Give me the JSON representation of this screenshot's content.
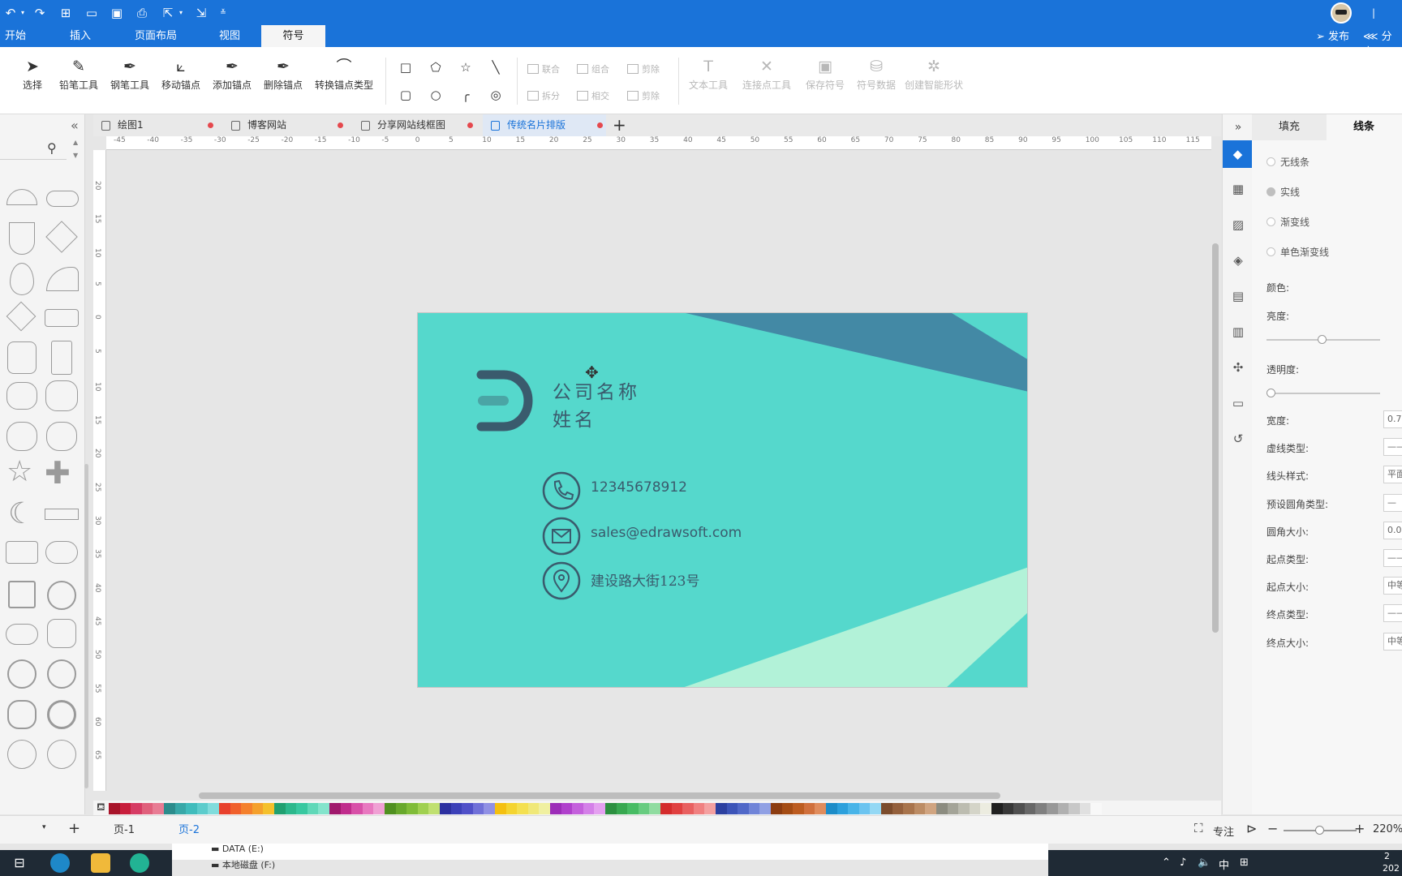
{
  "menu": {
    "items": [
      "开始",
      "插入",
      "页面布局",
      "视图",
      "符号"
    ],
    "active": "符号",
    "publish": "发布",
    "share": "分享"
  },
  "ribbon": {
    "tools": [
      "选择",
      "铅笔工具",
      "钢笔工具",
      "移动锚点",
      "添加锚点",
      "删除锚点",
      "转换锚点类型"
    ],
    "ops": [
      "联合",
      "组合",
      "剪除",
      "拆分",
      "相交",
      "剪除"
    ],
    "tools2": [
      "文本工具",
      "连接点工具",
      "保存符号",
      "符号数据",
      "创建智能形状"
    ]
  },
  "tabs": [
    {
      "label": "绘图1",
      "active": false
    },
    {
      "label": "博客网站",
      "active": false
    },
    {
      "label": "分享网站线框图",
      "active": false
    },
    {
      "label": "传统名片排版",
      "active": true
    }
  ],
  "ruler": {
    "h": [
      "-45",
      "-40",
      "-35",
      "-30",
      "-25",
      "-20",
      "-15",
      "-10",
      "-5",
      "0",
      "5",
      "10",
      "15",
      "20",
      "25",
      "30",
      "35",
      "40",
      "45",
      "50",
      "55",
      "60",
      "65",
      "70",
      "75",
      "80",
      "85",
      "90",
      "95",
      "100",
      "105",
      "110",
      "115"
    ],
    "v": [
      "20",
      "15",
      "10",
      "5",
      "0",
      "5",
      "10",
      "15",
      "20",
      "25",
      "30",
      "35",
      "40",
      "45",
      "50",
      "55",
      "60",
      "65"
    ]
  },
  "card": {
    "company": "公司名称",
    "name": "姓名",
    "phone": "12345678912",
    "email": "sales@edrawsoft.com",
    "address": "建设路大街123号",
    "colors": {
      "bg": "#55d8cc",
      "dark": "#4389a5",
      "light": "#b2f2d8",
      "text": "#3a5b6d"
    }
  },
  "panel": {
    "tab_fill": "填充",
    "tab_line": "线条",
    "active_tab": "线条",
    "options": [
      "无线条",
      "实线",
      "渐变线",
      "单色渐变线"
    ],
    "selected_option": "实线",
    "color_label": "颜色:",
    "brightness_label": "亮度:",
    "opacity_label": "透明度:",
    "props": [
      {
        "label": "宽度:",
        "value": "0.7"
      },
      {
        "label": "虚线类型:",
        "value": "——"
      },
      {
        "label": "线头样式:",
        "value": "平面"
      },
      {
        "label": "预设圆角类型:",
        "value": "—"
      },
      {
        "label": "圆角大小:",
        "value": "0.0"
      },
      {
        "label": "起点类型:",
        "value": "——"
      },
      {
        "label": "起点大小:",
        "value": "中等"
      },
      {
        "label": "终点类型:",
        "value": "——"
      },
      {
        "label": "终点大小:",
        "value": "中等"
      }
    ]
  },
  "statusbar": {
    "pages": [
      "页-1",
      "页-2"
    ],
    "active_page": "页-2",
    "focus": "专注",
    "zoom": "220%"
  },
  "explorer": [
    "DATA (E:)",
    "本地磁盘 (F:)"
  ],
  "tray": {
    "ime": "中",
    "time": "2",
    "date": "202"
  }
}
